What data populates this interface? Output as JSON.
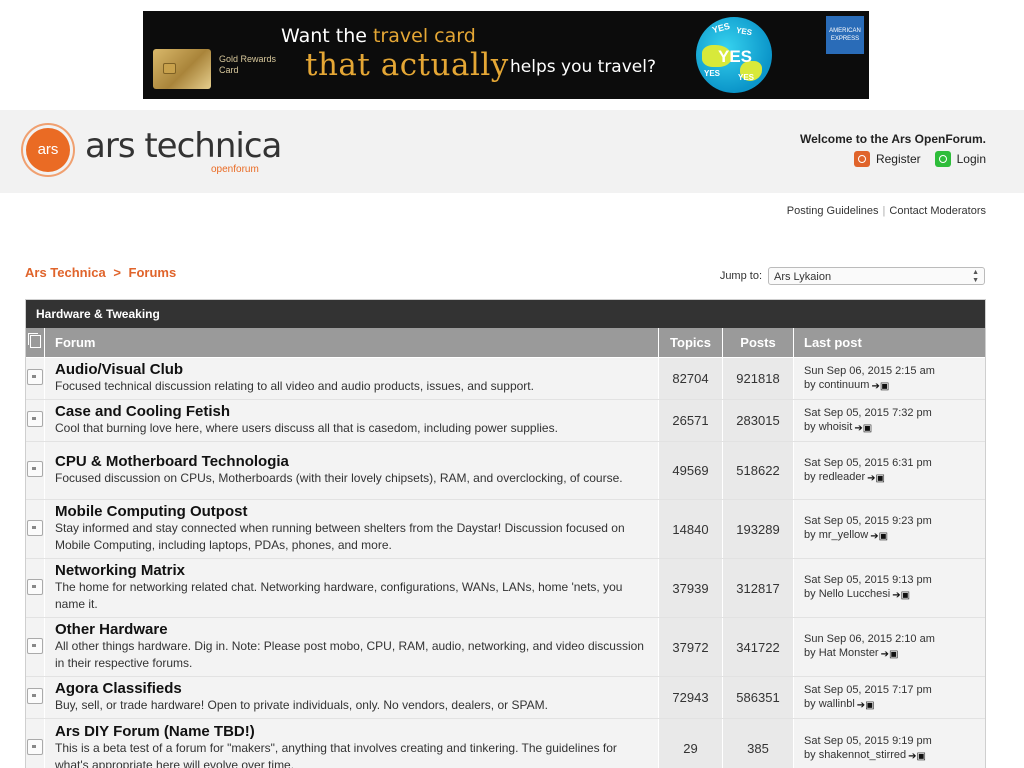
{
  "ad": {
    "card_label": "Gold Rewards Card",
    "line1_prefix": "Want the",
    "line1_highlight": "travel card",
    "line2_highlight": "that actually",
    "line2_suffix": "helps you travel?",
    "globe_words": [
      "YES",
      "YES",
      "YES",
      "YES",
      "YES"
    ],
    "brand": "AMERICAN EXPRESS"
  },
  "header": {
    "logo_badge": "ars",
    "logo_text": "ars technica",
    "logo_sub": "openforum",
    "welcome": "Welcome to the Ars OpenForum.",
    "register_label": "Register",
    "login_label": "Login",
    "register_icon": "register-icon",
    "login_icon": "power-icon"
  },
  "toplinks": {
    "posting_guidelines": "Posting Guidelines",
    "separator": "|",
    "contact_moderators": "Contact Moderators"
  },
  "breadcrumb": {
    "home": "Ars Technica",
    "separator": ">",
    "current": "Forums"
  },
  "jump": {
    "label": "Jump to:",
    "selected": "Ars Lykaion"
  },
  "category": {
    "title": "Hardware & Tweaking",
    "columns": {
      "forum": "Forum",
      "topics": "Topics",
      "posts": "Posts",
      "last_post": "Last post"
    },
    "forums": [
      {
        "name": "Audio/Visual Club",
        "desc": "Focused technical discussion relating to all video and audio products, issues, and support.",
        "topics": "82704",
        "posts": "921818",
        "last_date": "Sun Sep 06, 2015 2:15 am",
        "by": "by",
        "last_user": "continuum"
      },
      {
        "name": "Case and Cooling Fetish",
        "desc": "Cool that burning love here, where users discuss all that is casedom, including power supplies.",
        "topics": "26571",
        "posts": "283015",
        "last_date": "Sat Sep 05, 2015 7:32 pm",
        "by": "by",
        "last_user": "whoisit"
      },
      {
        "name": "CPU & Motherboard Technologia",
        "desc": "Focused discussion on CPUs, Motherboards (with their lovely chipsets), RAM, and overclocking, of course.",
        "topics": "49569",
        "posts": "518622",
        "last_date": "Sat Sep 05, 2015 6:31 pm",
        "by": "by",
        "last_user": "redleader"
      },
      {
        "name": "Mobile Computing Outpost",
        "desc": "Stay informed and stay connected when running between shelters from the Daystar! Discussion focused on Mobile Computing, including laptops, PDAs, phones, and more.",
        "topics": "14840",
        "posts": "193289",
        "last_date": "Sat Sep 05, 2015 9:23 pm",
        "by": "by",
        "last_user": "mr_yellow"
      },
      {
        "name": "Networking Matrix",
        "desc": "The home for networking related chat. Networking hardware, configurations, WANs, LANs, home 'nets, you name it.",
        "topics": "37939",
        "posts": "312817",
        "last_date": "Sat Sep 05, 2015 9:13 pm",
        "by": "by",
        "last_user": "Nello Lucchesi"
      },
      {
        "name": "Other Hardware",
        "desc": "All other things hardware. Dig in. Note: Please post mobo, CPU, RAM, audio, networking, and video discussion in their respective forums.",
        "topics": "37972",
        "posts": "341722",
        "last_date": "Sun Sep 06, 2015 2:10 am",
        "by": "by",
        "last_user": "Hat Monster"
      },
      {
        "name": "Agora Classifieds",
        "desc": "Buy, sell, or trade hardware! Open to private individuals, only. No vendors, dealers, or SPAM.",
        "topics": "72943",
        "posts": "586351",
        "last_date": "Sat Sep 05, 2015 7:17 pm",
        "by": "by",
        "last_user": "wallinbl"
      },
      {
        "name": "Ars DIY Forum (Name TBD!)",
        "desc": "This is a beta test of a forum for \"makers\", anything that involves creating and tinkering. The guidelines for what's appropriate here will evolve over time.",
        "topics": "29",
        "posts": "385",
        "last_date": "Sat Sep 05, 2015 9:19 pm",
        "by": "by",
        "last_user": "shakennot_stirred"
      }
    ]
  },
  "colors": {
    "accent_orange": "#e0642b",
    "category_bar": "#333333",
    "column_header": "#9a9a9a",
    "login_green": "#2ebd3a"
  }
}
